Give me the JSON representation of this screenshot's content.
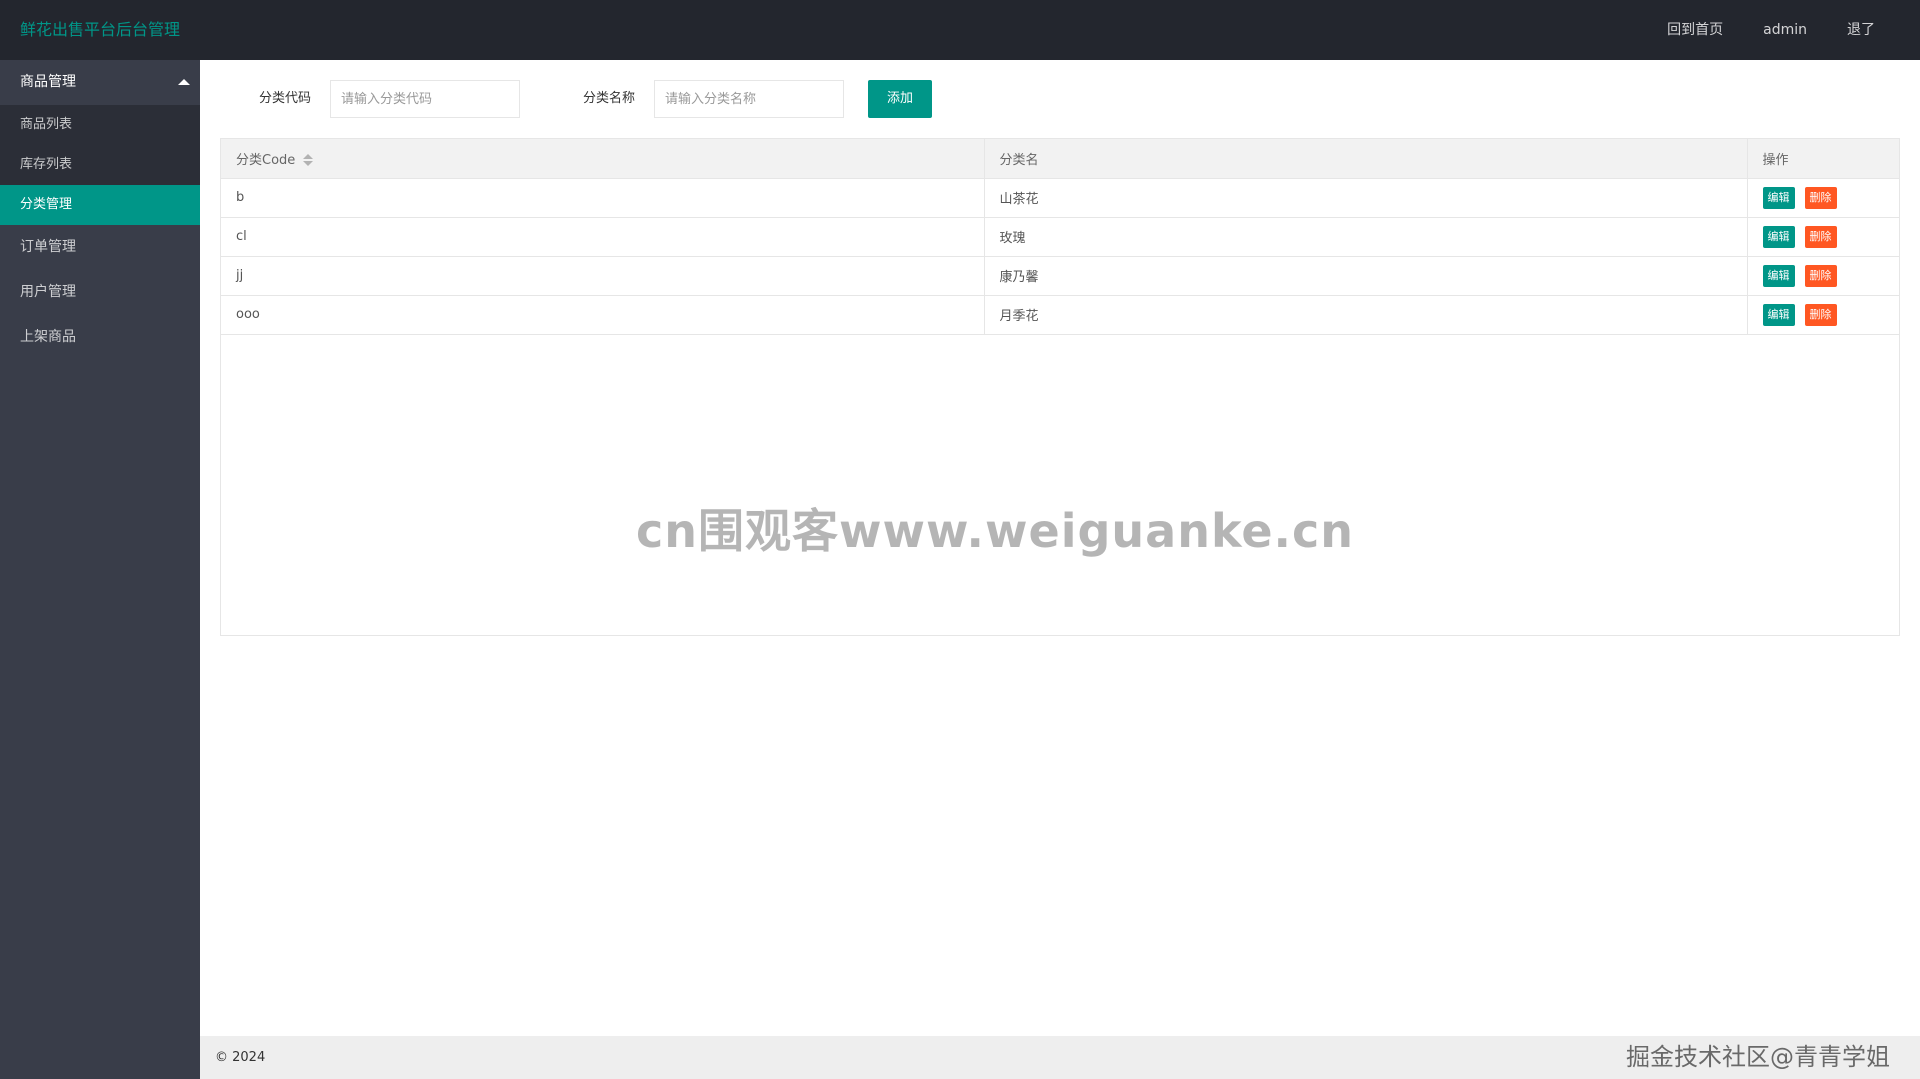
{
  "header": {
    "logo": "鲜花出售平台后台管理",
    "nav": [
      "回到首页",
      "admin",
      "退了"
    ]
  },
  "sidebar": {
    "group_title": "商品管理",
    "children": [
      "商品列表",
      "库存列表",
      "分类管理"
    ],
    "active_child": "分类管理",
    "items": [
      "订单管理",
      "用户管理",
      "上架商品"
    ]
  },
  "form": {
    "code_label": "分类代码",
    "code_placeholder": "请输入分类代码",
    "name_label": "分类名称",
    "name_placeholder": "请输入分类名称",
    "add_label": "添加"
  },
  "table": {
    "headers": [
      "分类Code",
      "分类名",
      "操作"
    ],
    "rows": [
      {
        "code": "b",
        "name": "山茶花"
      },
      {
        "code": "cl",
        "name": "玫瑰"
      },
      {
        "code": "jj",
        "name": "康乃馨"
      },
      {
        "code": "ooo",
        "name": "月季花"
      }
    ],
    "edit_label": "编辑",
    "delete_label": "删除"
  },
  "watermark": "cn围观客www.weiguanke.cn",
  "footer": {
    "copyright": "© 2024",
    "juejin": "掘金技术社区@青青学姐"
  },
  "colors": {
    "primary": "#009688",
    "danger": "#ff5722",
    "header_bg": "#23262e",
    "sidebar_bg": "#393d49"
  }
}
